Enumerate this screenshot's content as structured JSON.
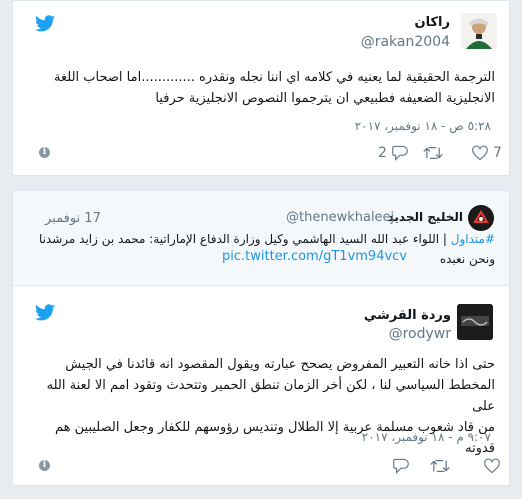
{
  "tweet1": {
    "name": "راكان",
    "handle": "@rakan2004",
    "text_line1": "الترجمة الحقيقية لما يعنيه في كلامه اي اننا نجله ونقدره .............اما اصحاب اللغة",
    "text_line2": "الانجليزية الضعيفه فطبيعي ان يترجموا النصوص الانجليزية حرفيا",
    "date": "٥:٢٨ ص - ١٨ نوفمبر، ٢٠١٧",
    "like_count": "7",
    "retweet_count": "",
    "reply_count": "2"
  },
  "quote": {
    "name": "الخليج الجديد",
    "handle": "@thenewkhaleej",
    "date": "17 نوفمبر",
    "hashtag": "#متداول",
    "text_line1": "| اللواء عبد الله السيد الهاشمي وكيل وزارة الدفاع الإماراتية: محمد بن زايد مرشدنا",
    "text_line2": "ونحن نعبده",
    "link": "pic.twitter.com/gT1vm94vcv"
  },
  "tweet2": {
    "name": "وردة القرشي",
    "handle": "@rodywr",
    "text_line1": "حتى اذا خانه التعبير المفروض يصحح عبارته ويقول المقصود انه قائدنا في الجيش",
    "text_line2": "المخطط السياسي لنا ، لكن أخر الزمان تنطق الحمير وتتحدث وتقود امم الا لعنة الله على",
    "text_line3": "من قاد شعوب مسلمة عربية إلا الطلال وتنديس رؤوسهم للكفار وجعل الصليبين هم قدوته",
    "date": "٩:٠٧ م - ١٨ نوفمبر، ٢٠١٧",
    "like_count": "",
    "retweet_count": "",
    "reply_count": ""
  },
  "icons": {
    "bird": "twitter-bird-icon",
    "like": "heart-icon",
    "retweet": "retweet-icon",
    "reply": "reply-icon",
    "info": "info-icon"
  },
  "colors": {
    "brand": "#1da1f2",
    "link": "#1b95e0",
    "muted": "#657786"
  }
}
